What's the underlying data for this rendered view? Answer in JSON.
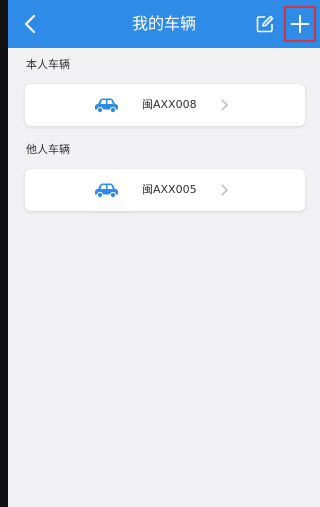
{
  "header": {
    "title": "我的车辆",
    "back_icon": "chevron-left-icon",
    "edit_icon": "edit-icon",
    "add_icon": "plus-icon"
  },
  "sections": [
    {
      "title": "本人车辆",
      "vehicle": {
        "plate": "闽AXX008",
        "icon": "car-icon"
      }
    },
    {
      "title": "他人车辆",
      "vehicle": {
        "plate": "闽AXX005",
        "icon": "car-icon"
      }
    }
  ],
  "colors": {
    "header": "#2f8be8",
    "car_icon": "#2f8be8",
    "highlight": "#d2333e",
    "background": "#f1f1f4"
  }
}
